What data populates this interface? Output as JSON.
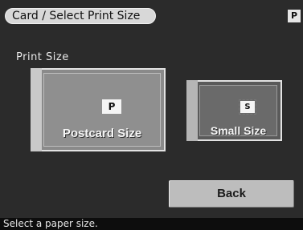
{
  "header": {
    "title": "Card / Select Print Size",
    "corner_badge": "P"
  },
  "section": {
    "label": "Print Size"
  },
  "options": [
    {
      "badge": "P",
      "label": "Postcard Size"
    },
    {
      "badge": "S",
      "label": "Small Size"
    }
  ],
  "back_button": {
    "label": "Back"
  },
  "status": {
    "message": "Select a paper size."
  }
}
